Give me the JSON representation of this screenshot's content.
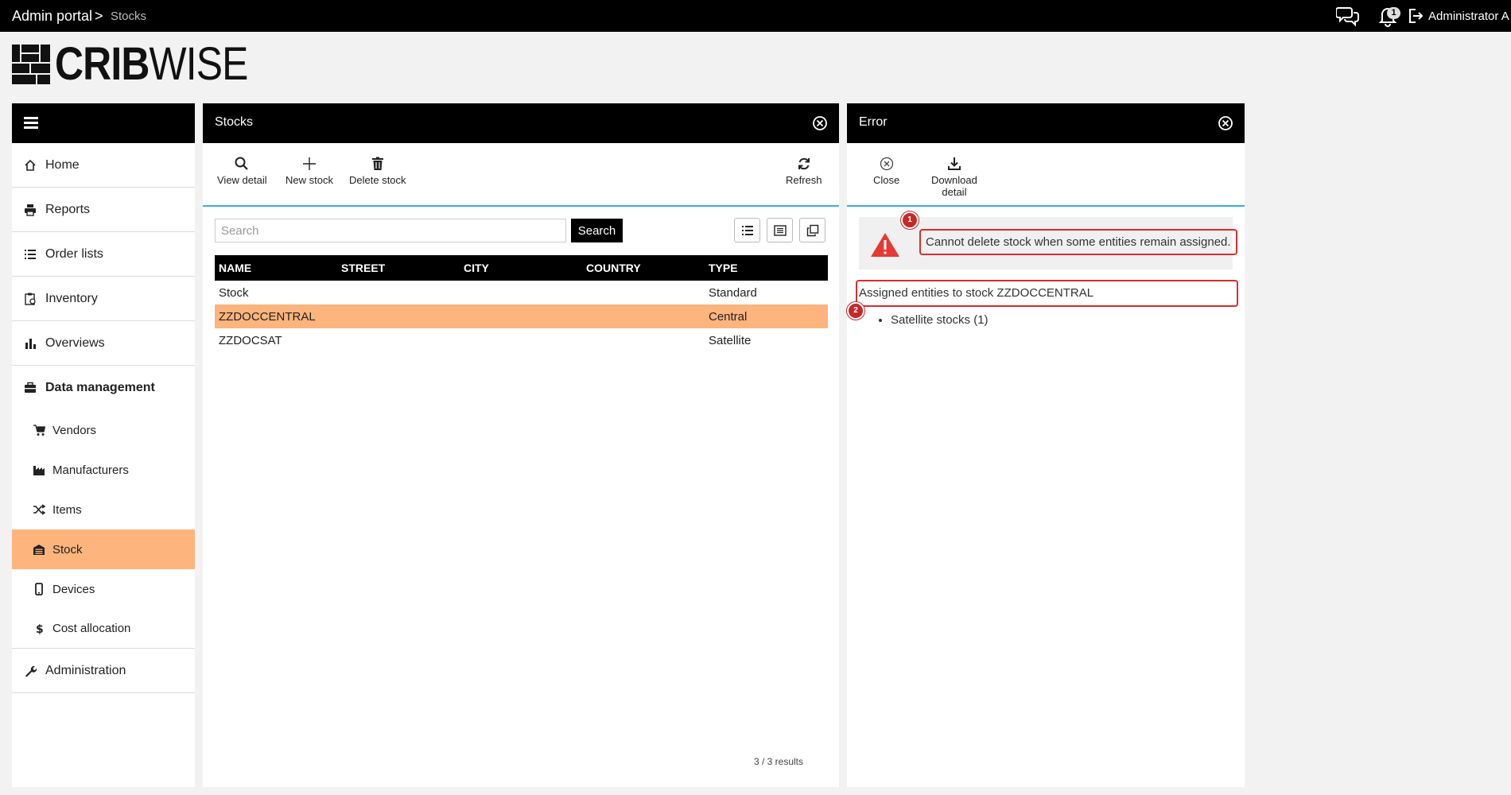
{
  "topbar": {
    "breadcrumb_root": "Admin portal",
    "breadcrumb_separator": ">",
    "breadcrumb_current": "Stocks",
    "notification_count": "1",
    "user_name": "Administrator A"
  },
  "logo": {
    "part1": "CRIB",
    "part2": "WISE"
  },
  "sidebar": {
    "items": [
      {
        "label": "Home",
        "icon": "home-icon"
      },
      {
        "label": "Reports",
        "icon": "printer-icon"
      },
      {
        "label": "Order lists",
        "icon": "list-icon"
      },
      {
        "label": "Inventory",
        "icon": "clipboard-icon"
      },
      {
        "label": "Overviews",
        "icon": "bar-chart-icon"
      }
    ],
    "group": {
      "label": "Data management",
      "icon": "briefcase-icon"
    },
    "subitems": [
      {
        "label": "Vendors",
        "icon": "cart-icon"
      },
      {
        "label": "Manufacturers",
        "icon": "factory-icon"
      },
      {
        "label": "Items",
        "icon": "shuffle-icon"
      },
      {
        "label": "Stock",
        "icon": "warehouse-icon",
        "active": true
      },
      {
        "label": "Devices",
        "icon": "mobile-icon"
      },
      {
        "label": "Cost allocation",
        "icon": "dollar-icon"
      }
    ],
    "admin": {
      "label": "Administration",
      "icon": "wrench-icon"
    }
  },
  "stocks_panel": {
    "title": "Stocks",
    "toolbar": {
      "view_detail": "View detail",
      "new_stock": "New stock",
      "delete_stock": "Delete stock",
      "refresh": "Refresh"
    },
    "search": {
      "placeholder": "Search",
      "value": "",
      "button": "Search"
    },
    "columns": [
      "NAME",
      "STREET",
      "CITY",
      "COUNTRY",
      "TYPE"
    ],
    "rows": [
      {
        "name": "Stock",
        "street": "",
        "city": "",
        "country": "",
        "type": "Standard"
      },
      {
        "name": "ZZDOCCENTRAL",
        "street": "",
        "city": "",
        "country": "",
        "type": "Central",
        "selected": true
      },
      {
        "name": "ZZDOCSAT",
        "street": "",
        "city": "",
        "country": "",
        "type": "Satellite"
      }
    ],
    "results": "3 / 3 results"
  },
  "error_panel": {
    "title": "Error",
    "toolbar": {
      "close": "Close",
      "download_line1": "Download",
      "download_line2": "detail"
    },
    "message": "Cannot delete stock when some entities remain assigned.",
    "assigned_heading": "Assigned entities to stock ZZDOCCENTRAL",
    "assigned_items": [
      "Satellite stocks (1)"
    ],
    "markers": [
      "1",
      "2"
    ]
  },
  "colors": {
    "accent": "#fdb47d",
    "header": "#000000",
    "toolbar_underline": "#3fa9dc",
    "error": "#d32f2f"
  }
}
